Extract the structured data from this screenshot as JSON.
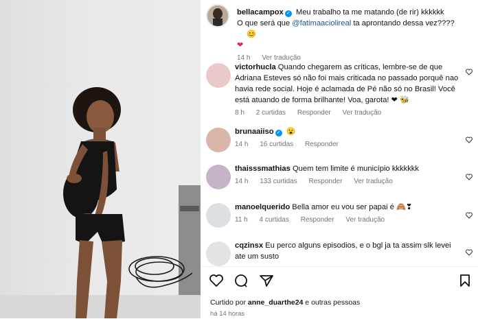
{
  "post": {
    "username": "bellacampox",
    "caption_line1": "Meu trabalho ta me matando (de rir) kkkkkk",
    "caption_pre": "O que será que ",
    "mention": "@fatimaaciolireal",
    "caption_post": " ta aprontando dessa vez????",
    "caption_emoji": "😊",
    "caption_heart": "❤",
    "time": "14 h",
    "see_translation": "Ver tradução"
  },
  "comments": [
    {
      "username": "victorhucla",
      "text": "Quando chegarem as críticas, lembre-se de que Adriana Esteves só não foi mais criticada no passado porquê nao havia rede social. Hoje é aclamada de Pé não só no Brasil! Você está atuando de forma brilhante! Voa, garota! ❤ 🐝",
      "time": "8 h",
      "likes": "2 curtidas",
      "reply": "Responder",
      "translate": "Ver tradução"
    },
    {
      "username": "brunaaiiso",
      "text": "😮",
      "time": "14 h",
      "likes": "16 curtidas",
      "reply": "Responder",
      "translate": ""
    },
    {
      "username": "thaisssmathias",
      "text": "Quem tem limite é município kkkkkkk",
      "time": "14 h",
      "likes": "133 curtidas",
      "reply": "Responder",
      "translate": "Ver tradução"
    },
    {
      "username": "manoelquerido",
      "text": "Bella amor eu vou ser papai é 🙈❣",
      "time": "11 h",
      "likes": "4 curtidas",
      "reply": "Responder",
      "translate": "Ver tradução"
    },
    {
      "username": "cqzinsx",
      "text": "Eu perco alguns episodios, e o bgl ja ta assim slk levei ate um susto",
      "time": "",
      "likes": "",
      "reply": "",
      "translate": ""
    }
  ],
  "footer": {
    "liked_by_pre": "Curtido por ",
    "liked_by_user": "anne_duarthe24",
    "liked_by_post": " e outras pessoas",
    "time": "há 14 horas"
  },
  "icons": [
    "heart-icon",
    "comment-icon",
    "share-icon",
    "bookmark-icon",
    "verified-badge-icon"
  ],
  "colors": {
    "verified": "#0095f6",
    "mention": "#1d4f8f",
    "meta_gray": "#737373",
    "heart_red": "#e0245e"
  }
}
